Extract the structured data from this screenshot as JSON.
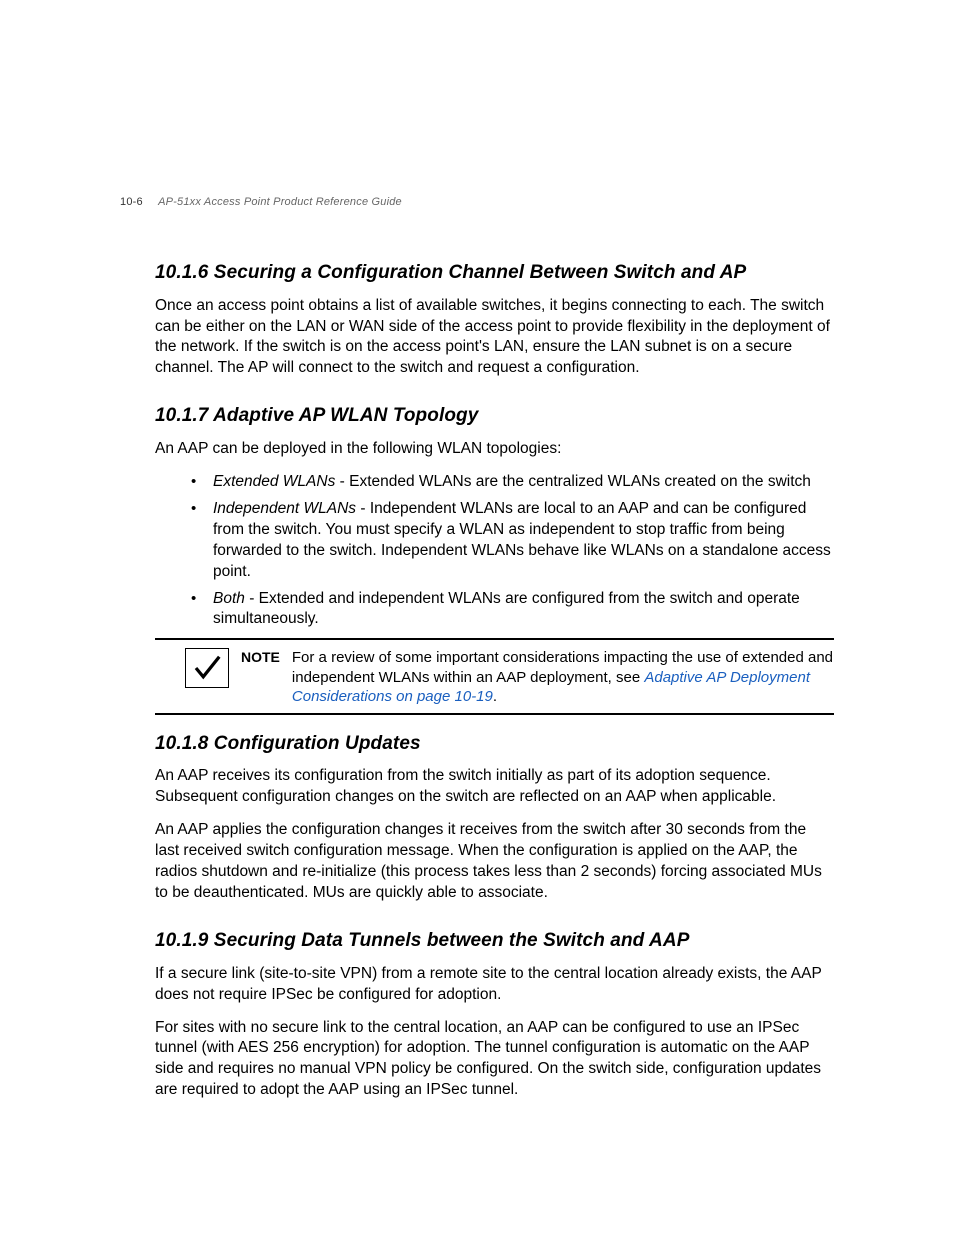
{
  "header": {
    "page_num": "10-6",
    "doc_title": "AP-51xx Access Point Product Reference Guide"
  },
  "s1": {
    "heading": "10.1.6  Securing a Configuration Channel Between Switch and AP",
    "p1": "Once an access point obtains a list of available switches, it begins connecting to each. The switch can be either on the LAN or WAN side of the access point to provide flexibility in the deployment of the network. If the switch is on the access point's LAN, ensure the LAN subnet is on a secure channel. The AP will connect to the switch and request a configuration."
  },
  "s2": {
    "heading": "10.1.7  Adaptive AP WLAN Topology",
    "intro": "An AAP can be deployed in the following WLAN topologies:",
    "b1_em": "Extended WLANs",
    "b1_txt": " - Extended WLANs are the centralized WLANs created on the switch",
    "b2_em": "Independent WLANs",
    "b2_txt": " - Independent WLANs are local to an AAP and can be configured from the switch. You must specify a WLAN as independent to stop traffic from being forwarded to the switch. Independent WLANs behave like WLANs on a standalone access point.",
    "b3_em": "Both",
    "b3_txt": " - Extended and independent WLANs are configured from the switch and operate simultaneously.",
    "note_label": "NOTE",
    "note_text": "For a review of some important considerations impacting the use of extended and independent WLANs within an AAP deployment, see ",
    "note_link": "Adaptive AP Deployment Considerations on page 10-19",
    "note_period": "."
  },
  "s3": {
    "heading": "10.1.8  Configuration Updates",
    "p1": "An AAP receives its configuration from the switch initially as part of its adoption sequence. Subsequent configuration changes on the switch are reflected on an AAP when applicable.",
    "p2": "An AAP applies the configuration changes it receives from the switch after 30 seconds from the last received switch configuration message. When the configuration is applied on the AAP, the radios shutdown and re-initialize (this process takes less than 2 seconds) forcing associated MUs to be deauthenticated. MUs are quickly able to associate."
  },
  "s4": {
    "heading": "10.1.9  Securing Data Tunnels between the Switch and AAP",
    "p1": "If a secure link (site-to-site VPN) from a remote site to the central location already exists, the AAP does not require IPSec be configured for adoption.",
    "p2": "For sites with no secure link to the central location, an AAP can be configured to use an IPSec tunnel (with AES 256 encryption) for adoption. The tunnel configuration is automatic on the AAP side and requires no manual VPN policy be configured. On the switch side, configuration updates are required to adopt the AAP using an IPSec tunnel."
  }
}
